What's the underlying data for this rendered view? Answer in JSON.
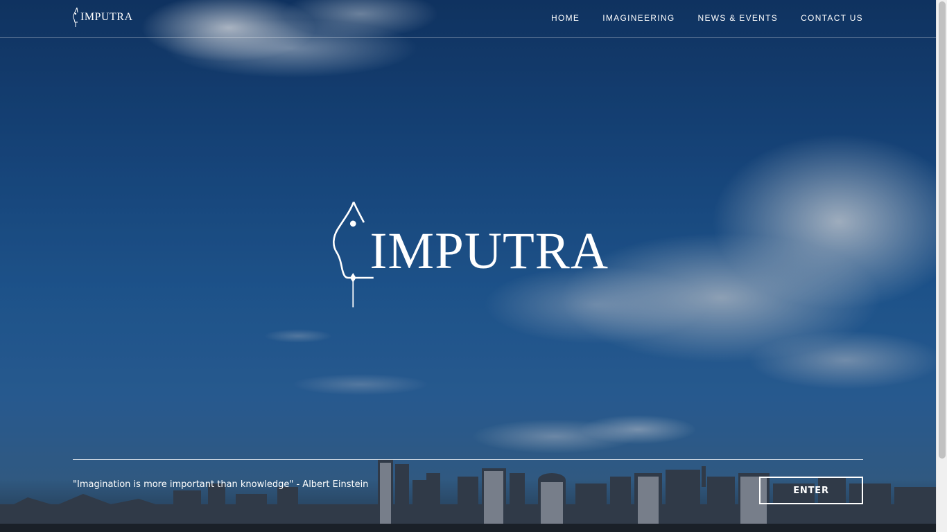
{
  "brand": {
    "logo_text": "IMPUTRA"
  },
  "nav": {
    "items": [
      "HOME",
      "IMAGINEERING",
      "NEWS & EVENTS",
      "CONTACT US"
    ]
  },
  "hero": {
    "logo_text": "IMPUTRA"
  },
  "footer": {
    "quote": "\"Imagination is more important than knowledge\" - Albert Einstein",
    "enter_label": "ENTER"
  },
  "colors": {
    "accent": "#ffffff",
    "sky": "#2361a2"
  }
}
